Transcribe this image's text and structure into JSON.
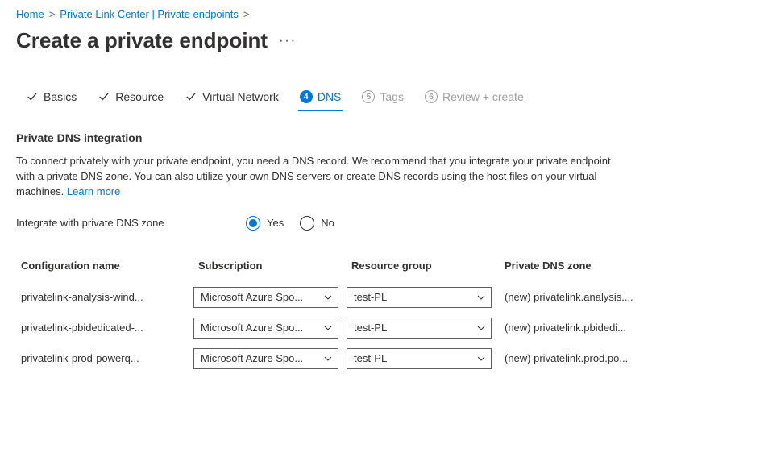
{
  "breadcrumb": {
    "home": "Home",
    "center": "Private Link Center | Private endpoints"
  },
  "title": "Create a private endpoint",
  "tabs": {
    "basics": "Basics",
    "resource": "Resource",
    "vnet": "Virtual Network",
    "dns": "DNS",
    "dns_num": "4",
    "tags": "Tags",
    "tags_num": "5",
    "review": "Review + create",
    "review_num": "6"
  },
  "section": {
    "heading": "Private DNS integration",
    "desc": "To connect privately with your private endpoint, you need a DNS record. We recommend that you integrate your private endpoint with a private DNS zone. You can also utilize your own DNS servers or create DNS records using the host files on your virtual machines.  ",
    "learn_more": "Learn more"
  },
  "form": {
    "integrate_label": "Integrate with private DNS zone",
    "yes": "Yes",
    "no": "No"
  },
  "table": {
    "headers": {
      "name": "Configuration name",
      "subscription": "Subscription",
      "rg": "Resource group",
      "zone": "Private DNS zone"
    },
    "rows": [
      {
        "name": "privatelink-analysis-wind...",
        "subscription": "Microsoft Azure Spo...",
        "rg": "test-PL",
        "zone": "(new) privatelink.analysis...."
      },
      {
        "name": "privatelink-pbidedicated-...",
        "subscription": "Microsoft Azure Spo...",
        "rg": "test-PL",
        "zone": "(new) privatelink.pbidedi..."
      },
      {
        "name": "privatelink-prod-powerq...",
        "subscription": "Microsoft Azure Spo...",
        "rg": "test-PL",
        "zone": "(new) privatelink.prod.po..."
      }
    ]
  }
}
